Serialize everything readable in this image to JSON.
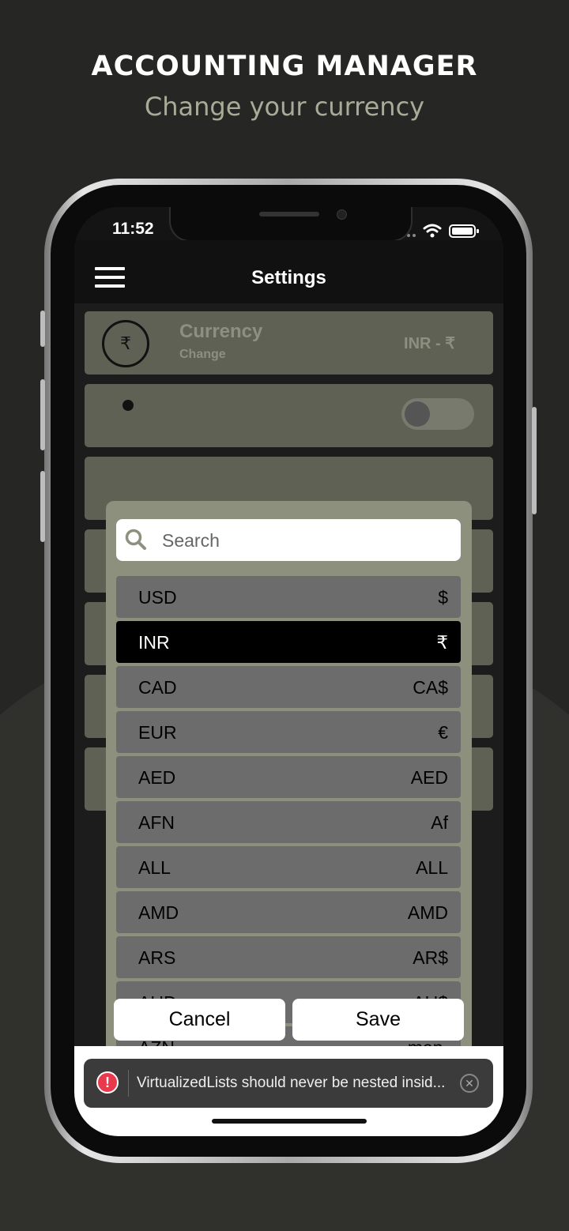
{
  "promo": {
    "headline": "ACCOUNTING MANAGER",
    "subline": "Change your currency"
  },
  "status_bar": {
    "time": "11:52"
  },
  "app_header": {
    "title": "Settings"
  },
  "currency_card": {
    "icon": "rupee-icon",
    "symbol": "₹",
    "title": "Currency",
    "subtitle": "Change",
    "value": "INR - ₹"
  },
  "picker": {
    "search_placeholder": "Search",
    "selected_code": "INR",
    "items": [
      {
        "code": "USD",
        "symbol": "$"
      },
      {
        "code": "INR",
        "symbol": "₹"
      },
      {
        "code": "CAD",
        "symbol": "CA$"
      },
      {
        "code": "EUR",
        "symbol": "€"
      },
      {
        "code": "AED",
        "symbol": "AED"
      },
      {
        "code": "AFN",
        "symbol": "Af"
      },
      {
        "code": "ALL",
        "symbol": "ALL"
      },
      {
        "code": "AMD",
        "symbol": "AMD"
      },
      {
        "code": "ARS",
        "symbol": "AR$"
      },
      {
        "code": "AUD",
        "symbol": "AU$"
      },
      {
        "code": "AZN",
        "symbol": "man."
      }
    ],
    "cancel_label": "Cancel",
    "save_label": "Save"
  },
  "toast": {
    "icon": "error-icon",
    "icon_glyph": "!",
    "message": "VirtualizedLists should never be nested insid...",
    "close_glyph": "✕"
  },
  "colors": {
    "background": "#262724",
    "modal": "#8d907c",
    "row": "#6c6c6c",
    "selected_row": "#000000",
    "toast_icon": "#e8394d"
  }
}
